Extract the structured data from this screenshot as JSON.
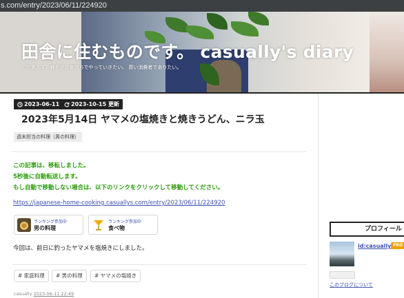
{
  "browser": {
    "url": "s.com/entry/2023/06/11/224920"
  },
  "header": {
    "title": "田舎に住むものです。 casually's diary",
    "description": "とりあえず、軽やかな気持ちでやっていきたい。     買い消費者でありたい。"
  },
  "article": {
    "published_date": "2023-06-11",
    "updated_date": "2023-10-15",
    "updated_label": "更新",
    "title": "2023年5月14日 ヤマメの塩焼きと焼きうどん、ニラ玉",
    "category": "週末担当の料理（男の料理）",
    "notice_lines": [
      "この記事は、移転しました。",
      "5秒後に自動転送します。",
      "もし自動で移動しない場合は、以下のリンクをクリックして移動してください。"
    ],
    "redirect_link": "https://japanese-home-cooking.casuallys.com/entry/2023/06/11/224920",
    "rankings": [
      {
        "small": "ランキング参加中",
        "big": "男の料理",
        "icon": "cooking-icon"
      },
      {
        "small": "ランキング参加中",
        "big": "食べ物",
        "icon": "cocktail-icon"
      }
    ],
    "body": "今回は、前日に釣ったヤマメを塩焼きにしました。",
    "tags": [
      "# 家庭料理",
      "# 男の料理",
      "# ヤマメの塩焼き"
    ],
    "byline_author": "casually",
    "byline_datetime": "2023-06-11 22:49"
  },
  "sidebar": {
    "profile_heading": "プロフィール",
    "profile_id": "id:casually",
    "pro_badge": "PRO",
    "about_link": "このブログについて"
  },
  "colors": {
    "notice_green": "#2a9d0a",
    "link_blue": "#3b4fb3",
    "badge_black": "#222222",
    "pro_orange": "#f0a000"
  }
}
